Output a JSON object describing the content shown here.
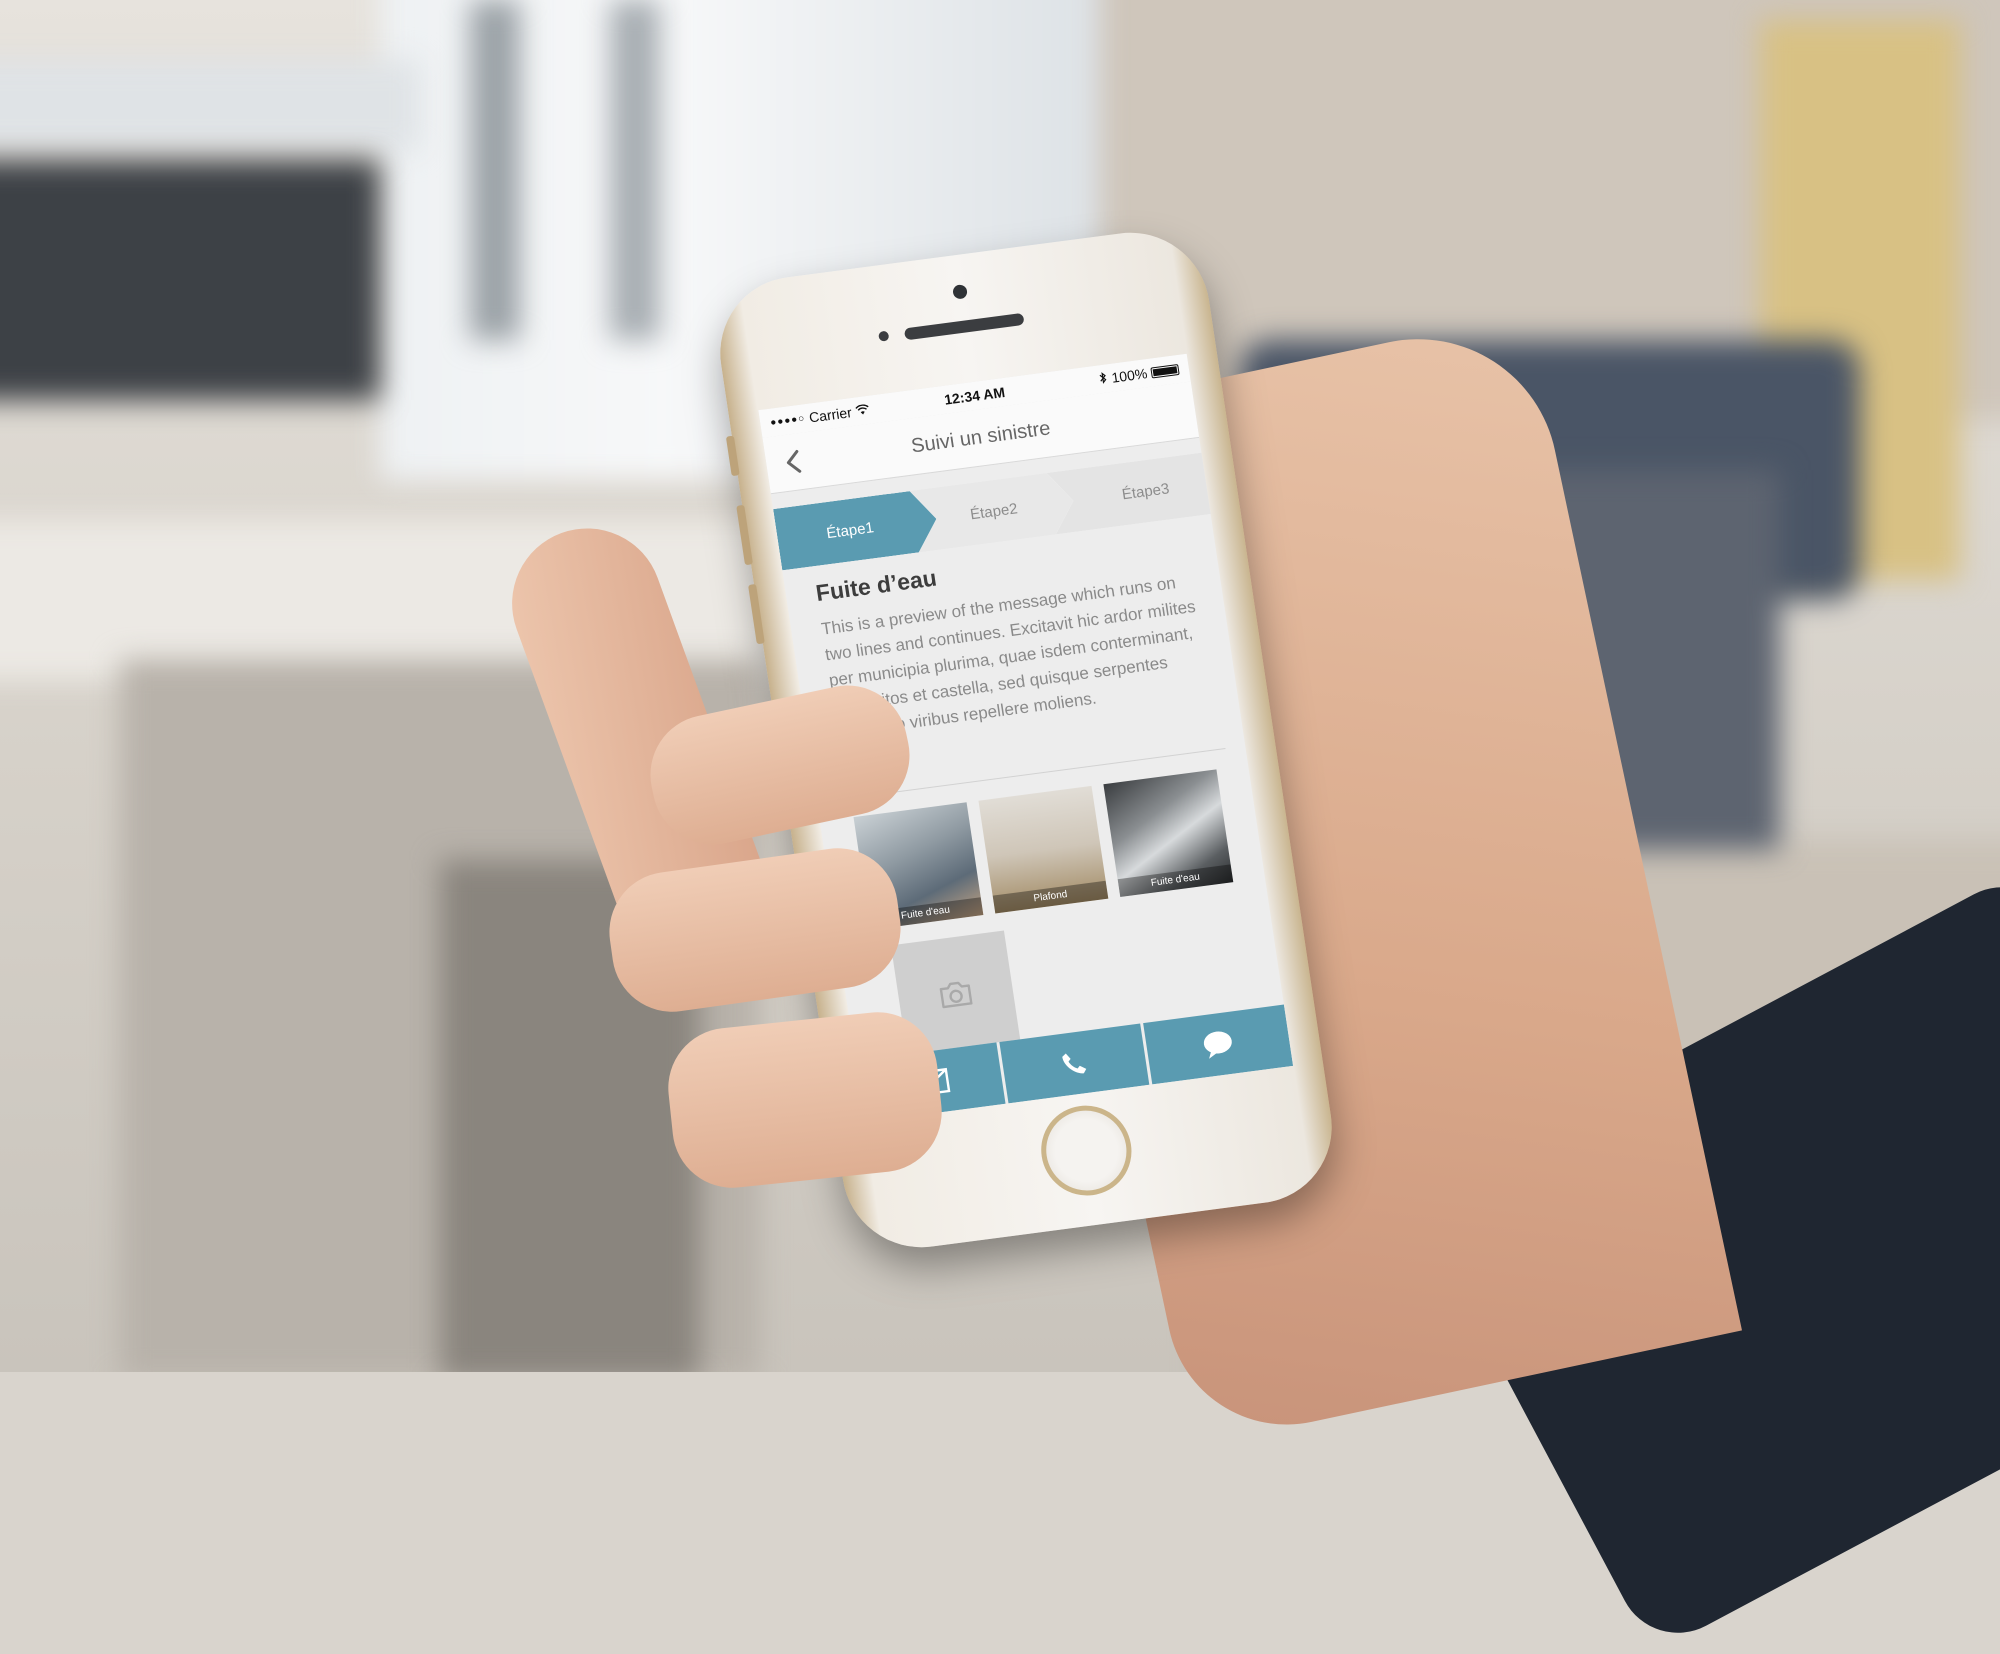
{
  "status_bar": {
    "signal": "●●●●○",
    "carrier": "Carrier",
    "time": "12:34 AM",
    "battery": "100%"
  },
  "nav": {
    "title": "Suivi un sinistre"
  },
  "steps": [
    "Étape1",
    "Étape2",
    "Étape3"
  ],
  "active_step": 1,
  "issue": {
    "title": "Fuite d’eau",
    "body": "This is a preview of the message which runs on two lines and continues. Excitavit hic ardor milites per municipia plurima, quae isdem conterminant, dispositos et castella, sed quisque serpentes latius pro viribus repellere moliens."
  },
  "photos": [
    {
      "caption": "Fuite d'eau"
    },
    {
      "caption": "Plafond"
    },
    {
      "caption": "Fuite d'eau"
    }
  ],
  "icons": {
    "back": "chevron-left-icon",
    "add_photo": "camera-icon",
    "mail": "mail-icon",
    "phone": "phone-icon",
    "chat": "chat-bubble-icon"
  },
  "colors": {
    "accent": "#5a9bb1",
    "inactive_step": "#e8e8e8"
  }
}
